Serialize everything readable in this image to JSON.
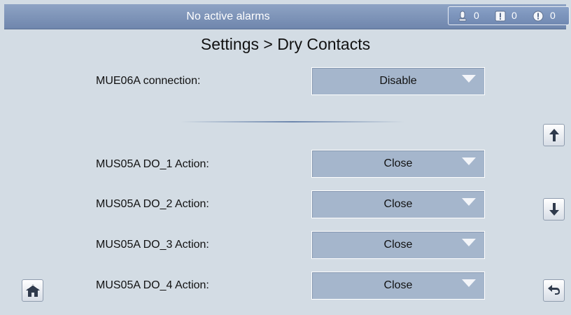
{
  "status_bar": {
    "message": "No active alarms",
    "alarms": [
      {
        "icon": "critical-alarm-icon",
        "count": "0"
      },
      {
        "icon": "major-alarm-icon",
        "count": "0"
      },
      {
        "icon": "minor-alarm-icon",
        "count": "0"
      }
    ]
  },
  "page": {
    "title": "Settings > Dry Contacts"
  },
  "settings": [
    {
      "label": "MUE06A connection:",
      "value": "Disable"
    },
    {
      "label": "MUS05A DO_1 Action:",
      "value": "Close"
    },
    {
      "label": "MUS05A DO_2 Action:",
      "value": "Close"
    },
    {
      "label": "MUS05A DO_3 Action:",
      "value": "Close"
    },
    {
      "label": "MUS05A DO_4 Action:",
      "value": "Close"
    }
  ],
  "nav": {
    "scroll_up_icon": "arrow-up-icon",
    "scroll_down_icon": "arrow-down-icon",
    "home_icon": "home-icon",
    "back_icon": "back-arrow-icon"
  }
}
